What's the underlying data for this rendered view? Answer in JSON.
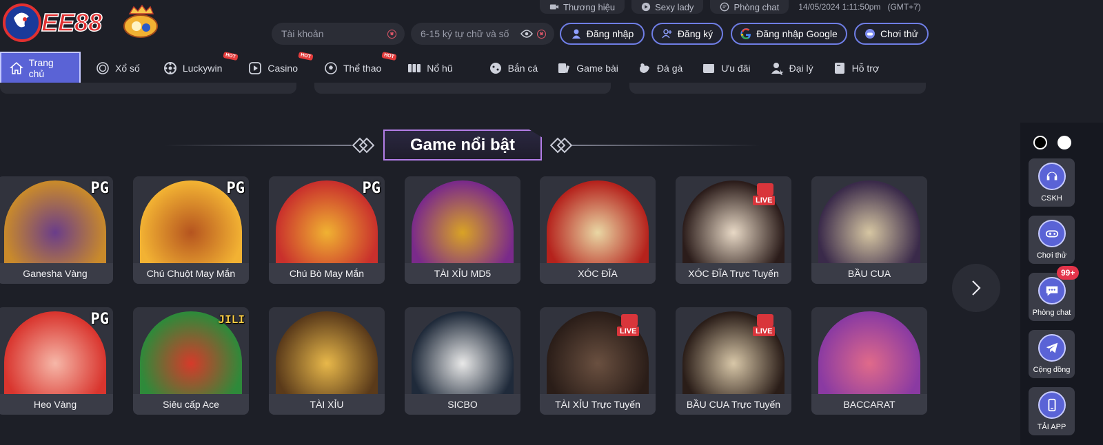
{
  "brand": {
    "logo_text": "EE88"
  },
  "topbar": {
    "links": [
      {
        "label": "Thương hiệu",
        "icon": "video-camera-icon"
      },
      {
        "label": "Sexy lady",
        "icon": "play-circle-icon"
      },
      {
        "label": "Phòng chat",
        "icon": "chat-icon"
      }
    ],
    "datetime": "14/05/2024 1:11:50pm",
    "timezone": "(GMT+7)"
  },
  "login": {
    "account_placeholder": "Tài khoản",
    "password_placeholder": "6-15 ký tự chữ và số",
    "login_label": "Đăng nhập",
    "register_label": "Đăng ký",
    "google_label": "Đăng nhập Google",
    "trial_label": "Chơi thử"
  },
  "nav": {
    "items": [
      {
        "label": "Trang chủ",
        "icon": "home-icon",
        "active": true,
        "hot": false
      },
      {
        "label": "Xổ số",
        "icon": "lottery-icon",
        "active": false,
        "hot": false
      },
      {
        "label": "Luckywin",
        "icon": "wheel-icon",
        "active": false,
        "hot": true
      },
      {
        "label": "Casino",
        "icon": "play-square-icon",
        "active": false,
        "hot": true
      },
      {
        "label": "Thể thao",
        "icon": "soccer-ball-icon",
        "active": false,
        "hot": true
      },
      {
        "label": "Nổ hũ",
        "icon": "slot-machine-icon",
        "active": false,
        "hot": false
      },
      {
        "label": "Bắn cá",
        "icon": "fish-icon",
        "active": false,
        "hot": false
      },
      {
        "label": "Game bài",
        "icon": "cards-icon",
        "active": false,
        "hot": false
      },
      {
        "label": "Đá gà",
        "icon": "rooster-icon",
        "active": false,
        "hot": false
      },
      {
        "label": "Ưu đãi",
        "icon": "gift-icon",
        "active": false,
        "hot": false
      },
      {
        "label": "Đại lý",
        "icon": "agent-icon",
        "active": false,
        "hot": false
      },
      {
        "label": "Hỗ trợ",
        "icon": "book-icon",
        "active": false,
        "hot": false
      }
    ],
    "hot_label": "HOT"
  },
  "section": {
    "title": "Game nổi bật"
  },
  "games": [
    {
      "name": "Ganesha Vàng",
      "provider": "PG",
      "colors": [
        "#c98a2b",
        "#6a3d8a"
      ]
    },
    {
      "name": "Chú Chuột May Mắn",
      "provider": "PG",
      "colors": [
        "#f2b233",
        "#b5541f"
      ]
    },
    {
      "name": "Chú Bò May Mắn",
      "provider": "PG",
      "colors": [
        "#c9302c",
        "#f0b232"
      ]
    },
    {
      "name": "TÀI XỈU MD5",
      "provider": "",
      "colors": [
        "#7a2a8a",
        "#d9a325"
      ]
    },
    {
      "name": "XÓC ĐĨA",
      "provider": "",
      "colors": [
        "#b5221c",
        "#e9d7a4"
      ]
    },
    {
      "name": "XÓC ĐĨA Trực Tuyến",
      "provider": "LIVE",
      "colors": [
        "#2b1c1a",
        "#e8d9c6"
      ]
    },
    {
      "name": "BẦU CUA",
      "provider": "",
      "colors": [
        "#3a2a4a",
        "#d6c6a2"
      ]
    },
    {
      "name": "Heo Vàng",
      "provider": "PG",
      "colors": [
        "#d9352e",
        "#f6b7a8"
      ]
    },
    {
      "name": "Siêu cấp Ace",
      "provider": "JILI",
      "colors": [
        "#2e8a3a",
        "#d63a2a"
      ]
    },
    {
      "name": "TÀI XỈU",
      "provider": "",
      "colors": [
        "#5a3a1a",
        "#e8b84a"
      ]
    },
    {
      "name": "SICBO",
      "provider": "",
      "colors": [
        "#1f2a3a",
        "#e8e8e8"
      ]
    },
    {
      "name": "TÀI XỈU Trực Tuyến",
      "provider": "LIVE",
      "colors": [
        "#2a1d18",
        "#6a5040"
      ]
    },
    {
      "name": "BẦU CUA Trực Tuyến",
      "provider": "LIVE",
      "colors": [
        "#2a1d18",
        "#d8c7a8"
      ]
    },
    {
      "name": "BACCARAT",
      "provider": "",
      "colors": [
        "#8a3aa2",
        "#e06a8a"
      ]
    }
  ],
  "sidebar": {
    "buttons": [
      {
        "label": "CSKH",
        "icon": "headset-icon"
      },
      {
        "label": "Chơi thử",
        "icon": "gamepad-icon"
      },
      {
        "label": "Phòng chat",
        "icon": "chat-bubble-icon"
      },
      {
        "label": "Cộng đồng",
        "icon": "telegram-icon"
      },
      {
        "label": "TẢI APP",
        "icon": "phone-icon"
      }
    ],
    "chat_badge": "99+"
  }
}
